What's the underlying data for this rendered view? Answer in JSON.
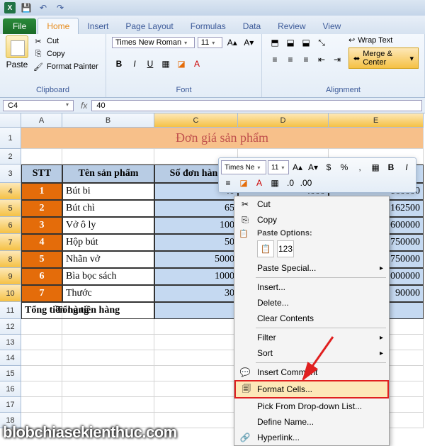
{
  "qat": {
    "app": "X"
  },
  "tabs": {
    "file": "File",
    "list": [
      "Home",
      "Insert",
      "Page Layout",
      "Formulas",
      "Data",
      "Review",
      "View"
    ],
    "active": 0
  },
  "ribbon": {
    "clipboard": {
      "label": "Clipboard",
      "paste": "Paste",
      "cut": "Cut",
      "copy": "Copy",
      "painter": "Format Painter"
    },
    "font": {
      "label": "Font",
      "name": "Times New Roman",
      "size": "11"
    },
    "alignment": {
      "label": "Alignment",
      "wrap": "Wrap Text",
      "merge": "Merge & Center"
    }
  },
  "namebox": "C4",
  "formula": "40",
  "cols": [
    {
      "l": "A",
      "w": 58
    },
    {
      "l": "B",
      "w": 130
    },
    {
      "l": "C",
      "w": 118
    },
    {
      "l": "D",
      "w": 128
    },
    {
      "l": "E",
      "w": 134
    }
  ],
  "rows": [
    {
      "n": 1,
      "h": 30
    },
    {
      "n": 2,
      "h": 22
    },
    {
      "n": 3,
      "h": 26
    },
    {
      "n": 4,
      "h": 24
    },
    {
      "n": 5,
      "h": 24
    },
    {
      "n": 6,
      "h": 24
    },
    {
      "n": 7,
      "h": 24
    },
    {
      "n": 8,
      "h": 24
    },
    {
      "n": 9,
      "h": 24
    },
    {
      "n": 10,
      "h": 24
    },
    {
      "n": 11,
      "h": 24
    },
    {
      "n": 12,
      "h": 22
    },
    {
      "n": 13,
      "h": 22
    },
    {
      "n": 14,
      "h": 22
    },
    {
      "n": 15,
      "h": 22
    },
    {
      "n": 16,
      "h": 22
    },
    {
      "n": 17,
      "h": 22
    },
    {
      "n": 18,
      "h": 22
    }
  ],
  "merged_title": "Đơn giá sản phẩm",
  "headers": [
    "STT",
    "Tên sản phẩm",
    "Số đơn hàng"
  ],
  "data_rows": [
    {
      "stt": "1",
      "ten": "Bút bi",
      "so": "40",
      "d": "4000",
      "e": "160000"
    },
    {
      "stt": "2",
      "ten": "Bút chì",
      "so": "65",
      "d": "",
      "e": "162500"
    },
    {
      "stt": "3",
      "ten": "Vở ô ly",
      "so": "100",
      "d": "",
      "e": "600000"
    },
    {
      "stt": "4",
      "ten": "Hộp bút",
      "so": "50",
      "d": "",
      "e": "750000"
    },
    {
      "stt": "5",
      "ten": "Nhãn vở",
      "so": "5000",
      "d": "",
      "e": "750000"
    },
    {
      "stt": "6",
      "ten": "Bìa bọc sách",
      "so": "1000",
      "d": "",
      "e": "1000000"
    },
    {
      "stt": "7",
      "ten": "Thước",
      "so": "30",
      "d": "",
      "e": "90000"
    }
  ],
  "total_label": "Tổng tiền hàng",
  "mini": {
    "font": "Times Ne",
    "size": "11"
  },
  "menu": {
    "cut": "Cut",
    "copy": "Copy",
    "paste_opts": "Paste Options:",
    "paste_special": "Paste Special...",
    "insert": "Insert...",
    "delete": "Delete...",
    "clear": "Clear Contents",
    "filter": "Filter",
    "sort": "Sort",
    "comment": "Insert Comment",
    "format": "Format Cells...",
    "dropdown": "Pick From Drop-down List...",
    "name": "Define Name...",
    "hyperlink": "Hyperlink..."
  },
  "watermark": "blobchiasekienthuc.com"
}
